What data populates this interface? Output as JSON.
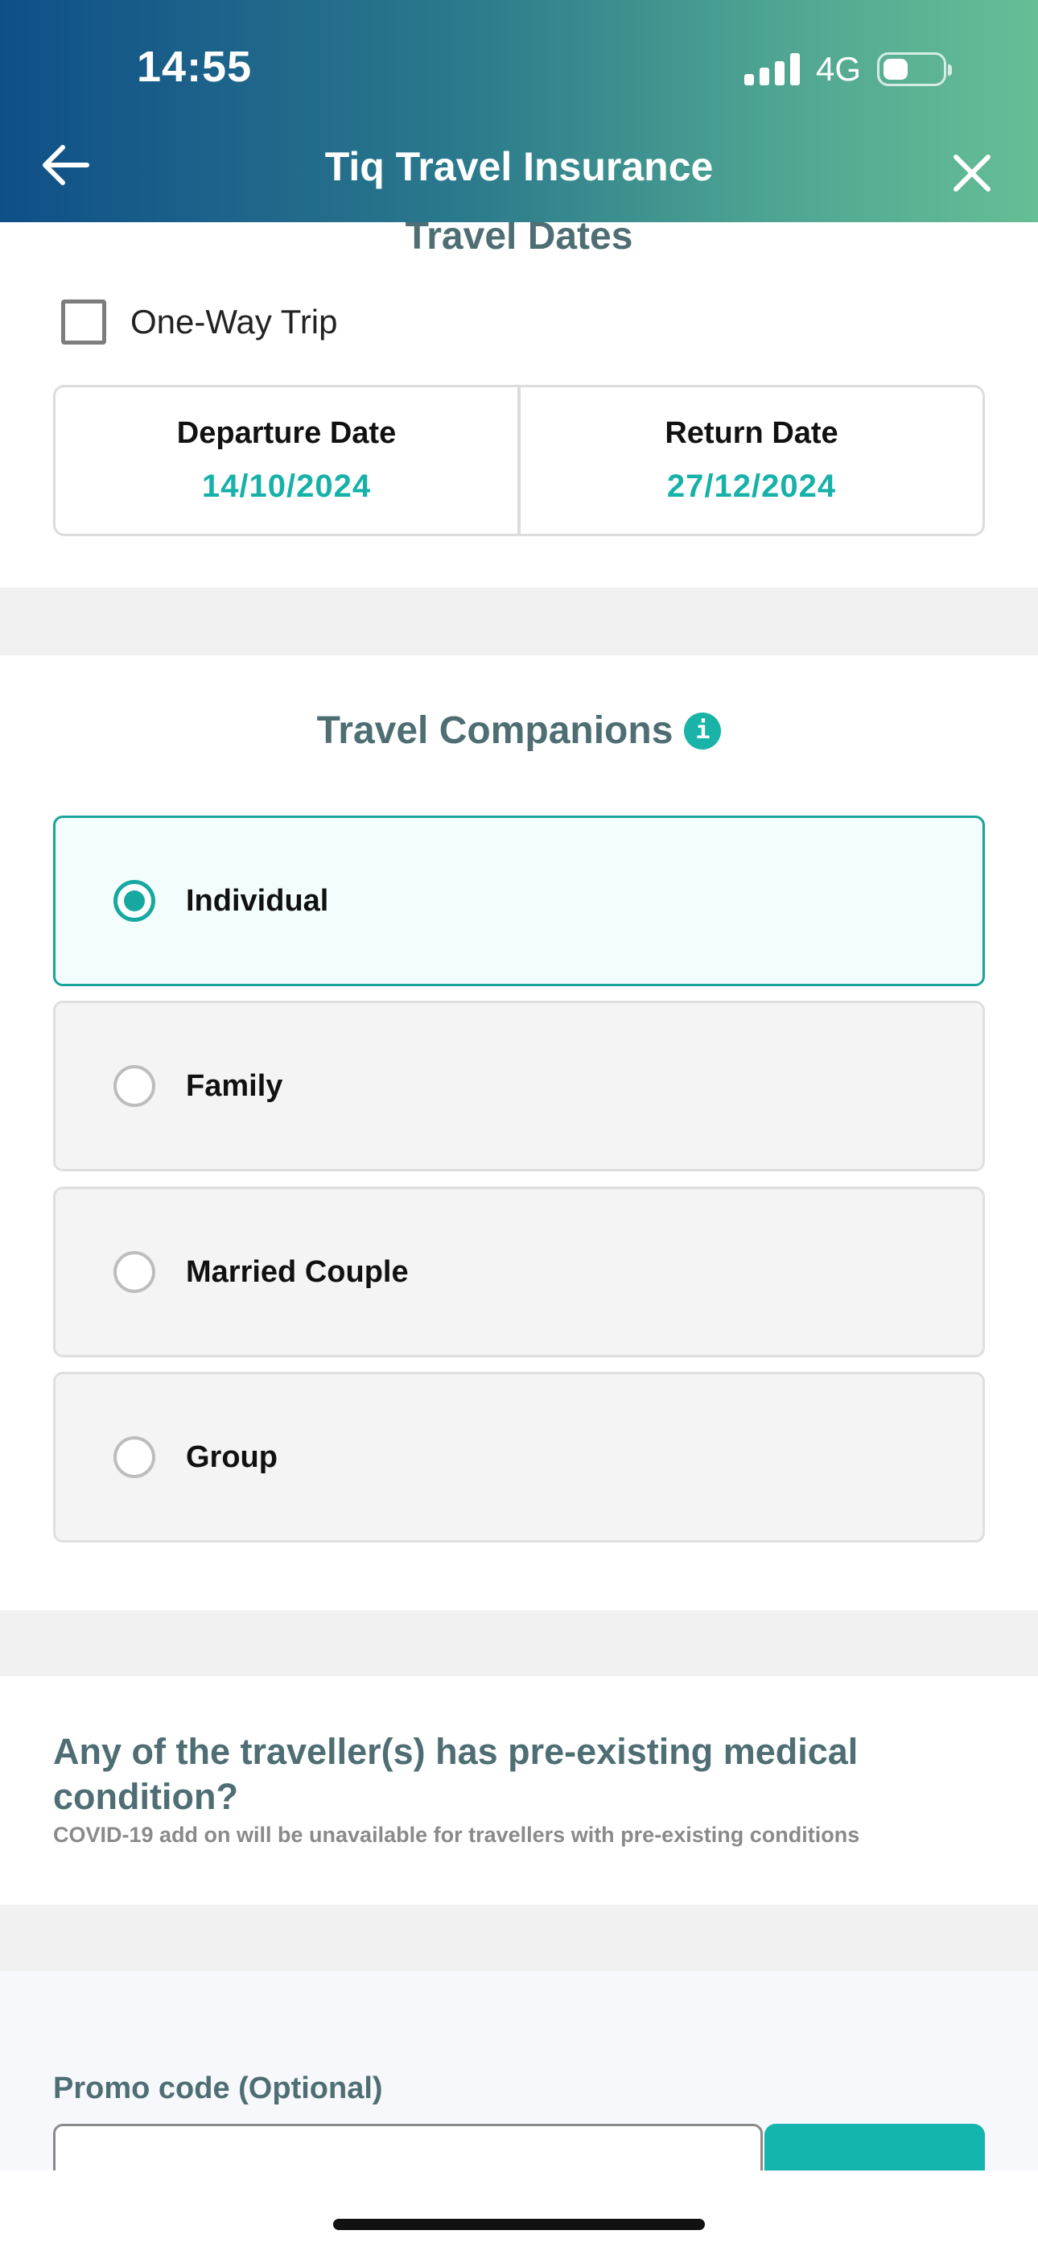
{
  "status_bar": {
    "time": "14:55",
    "network": "4G"
  },
  "header": {
    "title": "Tiq Travel Insurance",
    "back_icon": "arrow-left-icon",
    "close_icon": "close-icon"
  },
  "travel_dates": {
    "title": "Travel Dates",
    "one_way_label": "One-Way Trip",
    "one_way_checked": false,
    "departure_label": "Departure Date",
    "departure_value": "14/10/2024",
    "return_label": "Return Date",
    "return_value": "27/12/2024"
  },
  "companions": {
    "title": "Travel Companions",
    "info_glyph": "i",
    "options": [
      {
        "label": "Individual",
        "selected": true
      },
      {
        "label": "Family",
        "selected": false
      },
      {
        "label": "Married Couple",
        "selected": false
      },
      {
        "label": "Group",
        "selected": false
      }
    ]
  },
  "medical": {
    "question": "Any of the traveller(s) has pre-existing medical condition?",
    "note": "COVID-19 add on will be unavailable for travellers with pre-existing conditions"
  },
  "promo": {
    "label": "Promo code (Optional)"
  },
  "colors": {
    "accent": "#17b1a9",
    "heading": "#4e6e73",
    "header_gradient_start": "#0f4f88",
    "header_gradient_end": "#66be96"
  }
}
